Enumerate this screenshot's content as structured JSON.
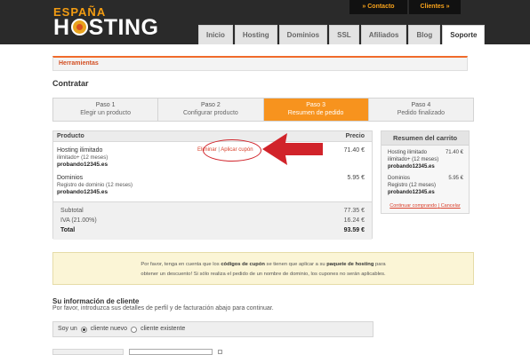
{
  "brand": {
    "logo_top": "ESPAÑA",
    "logo_main_left": "H",
    "logo_main_right": "STING",
    "accent": "#f7931e"
  },
  "top_links": [
    {
      "label": "» Contacto"
    },
    {
      "label": "Clientes »"
    }
  ],
  "nav": {
    "tabs": [
      {
        "label": "Inicio"
      },
      {
        "label": "Hosting"
      },
      {
        "label": "Dominios"
      },
      {
        "label": "SSL"
      },
      {
        "label": "Afiliados"
      },
      {
        "label": "Blog"
      },
      {
        "label": "Soporte"
      }
    ]
  },
  "breadcrumb": "Herramientas",
  "page_title": "Contratar",
  "steps": [
    {
      "title": "Paso 1",
      "sub": "Elegir un producto"
    },
    {
      "title": "Paso 2",
      "sub": "Configurar producto"
    },
    {
      "title": "Paso 3",
      "sub": "Resumen de pedido"
    },
    {
      "title": "Paso 4",
      "sub": "Pedido finalizado"
    }
  ],
  "cart": {
    "col_product": "Producto",
    "col_price": "Precio",
    "items": [
      {
        "name": "Hosting ilimitado",
        "sub": "ilimitado+ (12 meses)",
        "domain": "probando12345.es",
        "price": "71.40 €"
      },
      {
        "name": "Dominios",
        "sub": "Registro de dominio (12 meses)",
        "domain": "probando12345.es",
        "price": "5.95 €"
      }
    ],
    "remove_label": "Eliminar",
    "separator": "|",
    "coupon_label": "Aplicar cupón",
    "subtotal_label": "Subtotal",
    "subtotal_value": "77.35 €",
    "tax_label": "IVA (21.00%)",
    "tax_value": "16.24 €",
    "total_label": "Total",
    "total_value": "93.59 €"
  },
  "summary": {
    "title": "Resumen del carrito",
    "items": [
      {
        "line1": "Hosting ilimitado",
        "line2": "ilimitado+ (12 meses)",
        "domain": "probando12345.es",
        "price": "71.40 €"
      },
      {
        "line1": "Dominios",
        "line2": "Registro (12 meses)",
        "domain": "probando12345.es",
        "price": "5.95 €"
      }
    ],
    "continue_label": "Continuar comprando",
    "cancel_label": "Cancelar"
  },
  "notice": {
    "part1": "Por favor, tenga en cuenta que los",
    "bold1": "códigos de cupón",
    "part2": "se tienen que aplicar a su",
    "bold2": "paquete de hosting",
    "part3": "para",
    "line2": "obtener un descuento! Si sólo realiza el pedido de un nombre de dominio, los cupones no serán aplicables."
  },
  "client_info": {
    "title": "Su información de cliente",
    "subtitle": "Por favor, introduzca sus detalles de perfil y de facturación abajo para continuar.",
    "prefix": "Soy un",
    "option_new": "cliente nuevo",
    "option_existing": "cliente existente"
  }
}
